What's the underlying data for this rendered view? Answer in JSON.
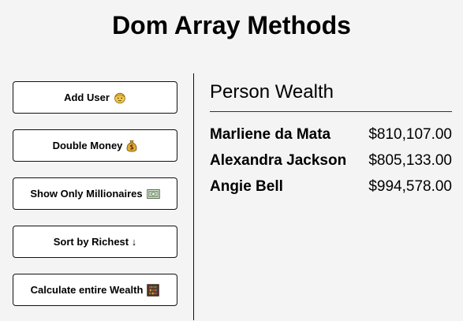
{
  "header": {
    "title": "Dom Array Methods"
  },
  "actions": {
    "add_user": {
      "label": "Add User",
      "icon": "person-face-icon"
    },
    "double_money": {
      "label": "Double Money",
      "icon": "money-bag-icon"
    },
    "show_millionaires": {
      "label": "Show Only Millionaires",
      "icon": "cash-bill-icon"
    },
    "sort_richest": {
      "label": "Sort by Richest ↓",
      "icon": "down-arrow-icon"
    },
    "calculate_wealth": {
      "label": "Calculate entire Wealth",
      "icon": "abacus-icon"
    }
  },
  "wealth": {
    "heading": "Person Wealth",
    "people": [
      {
        "name": "Marliene da Mata",
        "money": "$810,107.00"
      },
      {
        "name": "Alexandra Jackson",
        "money": "$805,133.00"
      },
      {
        "name": "Angie Bell",
        "money": "$994,578.00"
      }
    ]
  },
  "colors": {
    "background": "#f4f4f4",
    "button_background": "#ffffff",
    "border": "#111111",
    "text": "#000000"
  }
}
